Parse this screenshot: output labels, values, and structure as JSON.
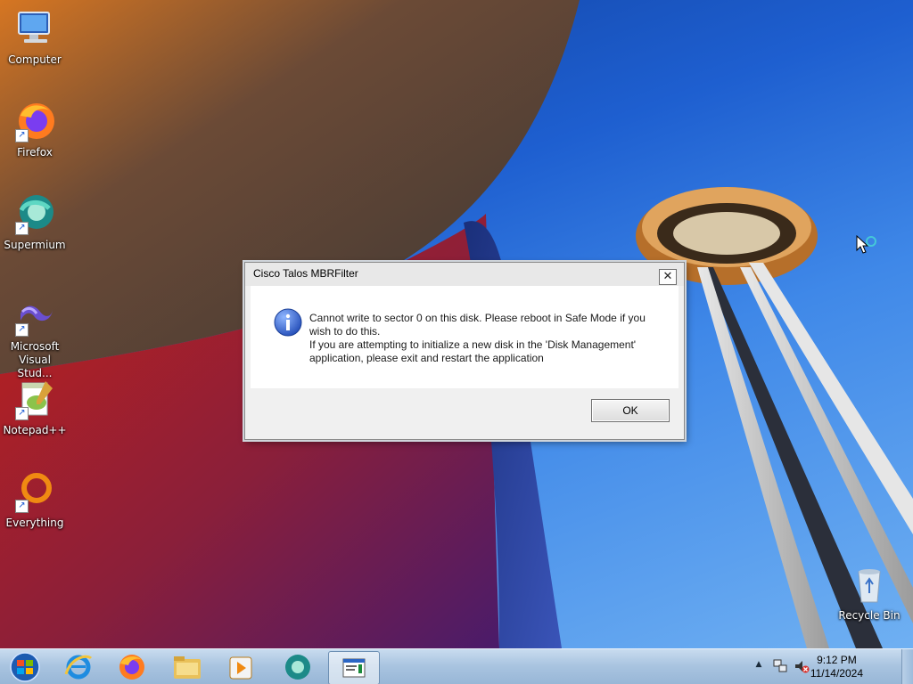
{
  "desktop_icons": [
    {
      "label": "Computer",
      "icon": "computer-icon"
    },
    {
      "label": "Firefox",
      "icon": "firefox-icon"
    },
    {
      "label": "Supermium",
      "icon": "supermium-icon"
    },
    {
      "label": "Microsoft Visual Stud...",
      "icon": "visual-studio-icon"
    },
    {
      "label": "Notepad++",
      "icon": "notepadpp-icon"
    },
    {
      "label": "Everything",
      "icon": "everything-icon"
    },
    {
      "label": "Recycle Bin",
      "icon": "recycle-bin-icon"
    }
  ],
  "dialog": {
    "title": "Cisco Talos MBRFilter",
    "line1": "Cannot write to sector 0 on this disk. Please reboot in Safe Mode if you",
    "line2": "wish to do this.",
    "line3": "If you are attempting to initialize a new disk in the 'Disk Management'",
    "line4": "application, please exit and restart the application",
    "ok_label": "OK",
    "close_glyph": "✕",
    "icon": "info-icon"
  },
  "taskbar": {
    "items": [
      "start-orb-icon",
      "internet-explorer-icon",
      "firefox-icon",
      "file-explorer-icon",
      "media-player-icon",
      "supermium-icon",
      "notepad-icon"
    ],
    "tray": {
      "chevron": "▲",
      "time": "9:12 PM",
      "date": "11/14/2024"
    }
  },
  "colors": {
    "info_blue": "#2a5fc9",
    "taskbar": "#a9c4e0",
    "dialog_bg": "#f0f0f0"
  }
}
